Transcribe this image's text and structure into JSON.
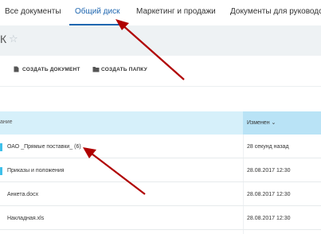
{
  "tabs": [
    {
      "label": "Все документы"
    },
    {
      "label": "Общий диск"
    },
    {
      "label": "Маркетинг и продажи"
    },
    {
      "label": "Документы для руководства"
    }
  ],
  "page": {
    "title_fragment": "К",
    "star_icon": "star-icon"
  },
  "toolbar": {
    "create_document_label": "СОЗДАТЬ ДОКУМЕНТ",
    "create_folder_label": "СОЗДАТЬ ПАПКУ"
  },
  "table": {
    "columns": [
      "ание",
      "Изменен"
    ],
    "sort_indicator": "⌄",
    "rows": [
      {
        "name": "ОАО _Прямые поставки_ (6)",
        "modified": "28 секунд назад",
        "is_folder": true
      },
      {
        "name": "Приказы и положения",
        "modified": "28.08.2017 12:30",
        "is_folder": true
      },
      {
        "name": "Анкета.docx",
        "modified": "28.08.2017 12:30",
        "is_folder": false
      },
      {
        "name": "Накладная.xls",
        "modified": "28.08.2017 12:30",
        "is_folder": false
      }
    ]
  },
  "colors": {
    "accent": "#2067b0",
    "header_bg": "#d6f0fa",
    "folder_mark": "#3fc0ea",
    "arrow": "#c00000"
  }
}
